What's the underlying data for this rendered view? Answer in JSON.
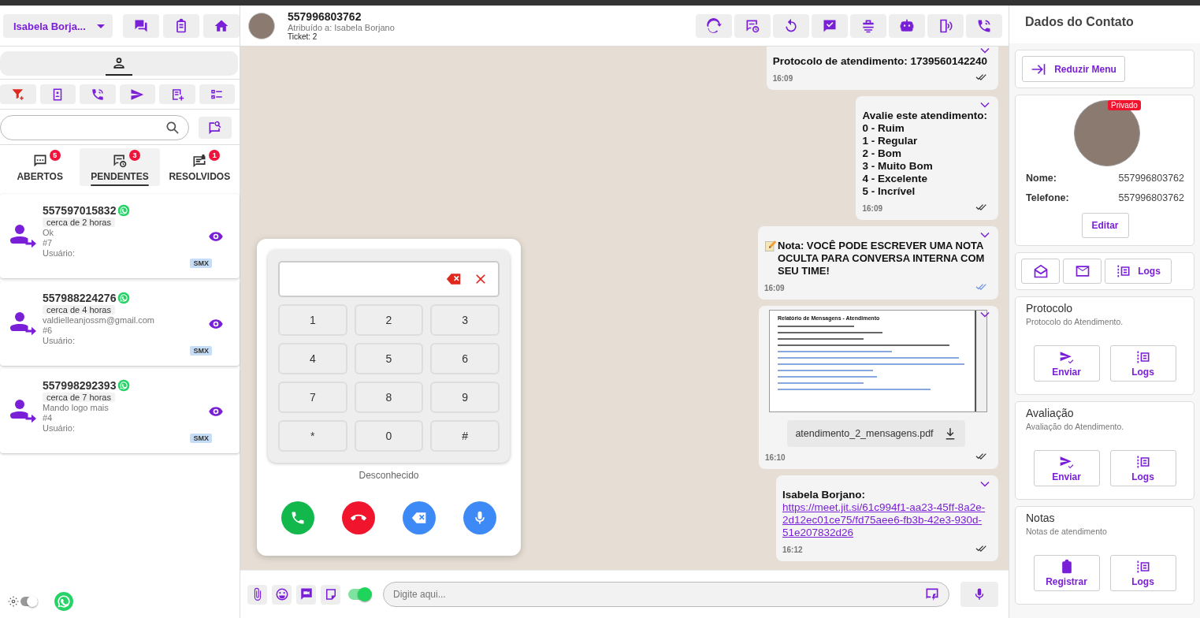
{
  "sidebar": {
    "user_menu": {
      "label": "Isabela Borja..."
    },
    "view_tabs": [
      {
        "selected": true
      }
    ],
    "ticket_tabs": [
      {
        "label": "ABERTOS",
        "count": "5",
        "selected": false
      },
      {
        "label": "PENDENTES",
        "count": "3",
        "selected": true
      },
      {
        "label": "RESOLVIDOS",
        "count": "1",
        "selected": false
      }
    ],
    "tickets": [
      {
        "number": "557597015832",
        "time": "cerca de 2 horas",
        "message": "Ok",
        "ticket_id": "#7",
        "user_label": "Usuário:",
        "tag": "SMX"
      },
      {
        "number": "557988224276",
        "time": "cerca de 4 horas",
        "message": "valdielleanjossm@gmail.com",
        "ticket_id": "#6",
        "user_label": "Usuário:",
        "tag": "SMX"
      },
      {
        "number": "557998292393",
        "time": "cerca de 7 horas",
        "message": "Mando logo mais",
        "ticket_id": "#4",
        "user_label": "Usuário:",
        "tag": "SMX"
      }
    ],
    "theme_toggle": {
      "on": false
    }
  },
  "chat": {
    "header": {
      "contact": "557996803762",
      "assigned": "Atribuído a: Isabela Borjano",
      "ticket": "Ticket: 2"
    },
    "messages": [
      {
        "kind": "text",
        "text": "Protocolo de atendimento: 1739560142240",
        "time": "16:09",
        "read": false
      },
      {
        "kind": "text",
        "text": "Avalie este atendimento:\n0 - Ruim\n1 - Regular\n2 - Bom\n3 - Muito Bom\n4 - Excelente\n5 - Incrível",
        "time": "16:09",
        "read": false
      },
      {
        "kind": "note",
        "text": "Nota: VOCÊ PODE ESCREVER UMA NOTA OCULTA PARA CONVERSA INTERNA COM SEU TIME!",
        "time": "16:09",
        "read": true
      },
      {
        "kind": "file",
        "preview_title": "Relatório de Mensagens - Atendimento",
        "filename": "atendimento_2_mensagens.pdf",
        "time": "16:10",
        "read": false
      },
      {
        "kind": "link",
        "sender": "Isabela Borjano:",
        "url": "https://meet.jit.si/61c994f1-aa23-45ff-8a2e-2d12ec01ce75/fd75aee6-fb3b-42e3-930d-51e207832d26",
        "time": "16:12",
        "read": false
      }
    ],
    "dialer": {
      "keys": [
        "1",
        "2",
        "3",
        "4",
        "5",
        "6",
        "7",
        "8",
        "9",
        "*",
        "0",
        "#"
      ],
      "caption": "Desconhecido"
    },
    "composer": {
      "placeholder": "Digite aqui...",
      "signature_toggle": {
        "on": true
      }
    }
  },
  "contact_panel": {
    "title": "Dados do Contato",
    "collapse_button": "Reduzir Menu",
    "badge": "Privado",
    "fields": [
      {
        "label": "Nome:",
        "value": "557996803762"
      },
      {
        "label": "Telefone:",
        "value": "557996803762"
      }
    ],
    "edit_button": "Editar",
    "logs_button": "Logs",
    "sections": [
      {
        "title": "Protocolo",
        "subtitle": "Protocolo do Atendimento.",
        "buttons": [
          {
            "kind": "send",
            "label": "Enviar"
          },
          {
            "kind": "logs",
            "label": "Logs"
          }
        ]
      },
      {
        "title": "Avaliação",
        "subtitle": "Avaliação do Atendimento.",
        "buttons": [
          {
            "kind": "send",
            "label": "Enviar"
          },
          {
            "kind": "logs",
            "label": "Logs"
          }
        ]
      },
      {
        "title": "Notas",
        "subtitle": "Notas de atendimento",
        "buttons": [
          {
            "kind": "register",
            "label": "Registrar"
          },
          {
            "kind": "logs",
            "label": "Logs"
          }
        ]
      }
    ]
  }
}
